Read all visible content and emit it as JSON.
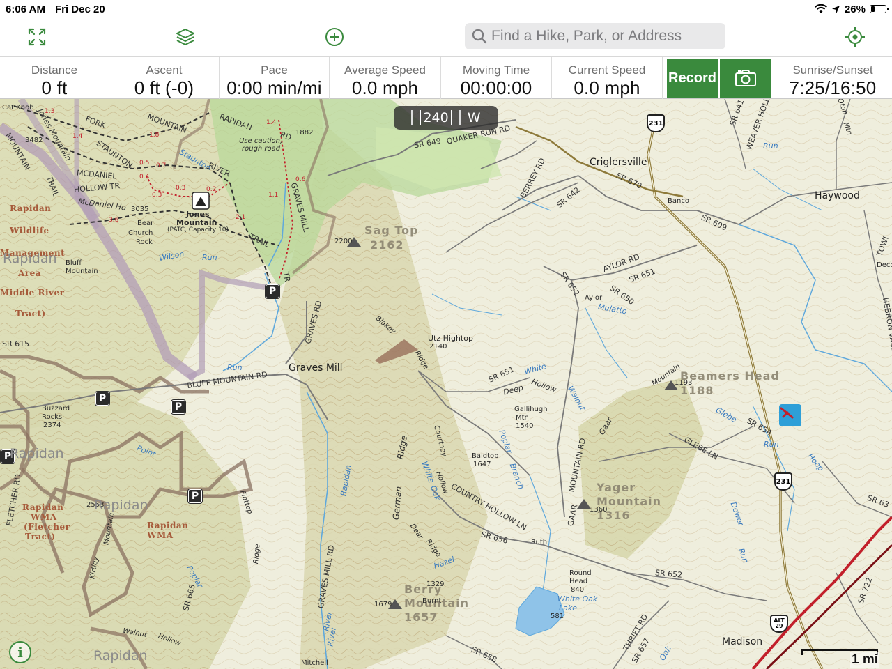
{
  "status": {
    "time": "6:06 AM",
    "date": "Fri Dec 20",
    "battery": "26%",
    "battery_level": 0.26
  },
  "toolbar": {
    "search_placeholder": "Find a Hike, Park, or Address",
    "icons": [
      "expand-icon",
      "layers-icon",
      "add-icon",
      "search-icon",
      "locate-icon"
    ]
  },
  "stats": {
    "distance": {
      "label": "Distance",
      "value": "0 ft"
    },
    "ascent": {
      "label": "Ascent",
      "value": "0 ft (-0)"
    },
    "pace": {
      "label": "Pace",
      "value": "0:00 min/mi"
    },
    "avg_speed": {
      "label": "Average Speed",
      "value": "0.0 mph"
    },
    "moving_time": {
      "label": "Moving Time",
      "value": "00:00:00"
    },
    "current_speed": {
      "label": "Current Speed",
      "value": "0.0 mph"
    },
    "record_label": "Record",
    "sun": {
      "label": "Sunrise/Sunset",
      "value": "7:25/16:50"
    }
  },
  "compass": {
    "heading": "240",
    "direction": "W"
  },
  "scale": {
    "label": "1 mi"
  },
  "map": {
    "towns": {
      "criglersville": "Criglersville",
      "haywood": "Haywood",
      "graves_mill": "Graves Mill",
      "madison": "Madison",
      "banco": "Banco",
      "aylor": "Aylor",
      "ruth": "Ruth"
    },
    "peaks": {
      "sag_top": "Sag Top",
      "sag_top_elev": "2162",
      "beamers_head": "Beamers Head",
      "beamers_elev": "1188",
      "yager": "Yager",
      "yager_mountain": "Mountain",
      "yager_elev": "1316",
      "berry": "Berry",
      "berry_mountain": "Mountain",
      "berry_elev": "1657",
      "utz": "Utz Hightop",
      "utz_elev": "2140",
      "gallihugh": "Gallihugh",
      "gallihugh_mtn": "Mtn",
      "gallihugh_elev": "1540",
      "baldtop": "Baldtop",
      "baldtop_elev": "1647",
      "jones": "Jones",
      "jones_mountain": "Mountain",
      "jones_capacity": "(PATC, Capacity 10)",
      "buzzard": "Buzzard",
      "buzzard_rocks": "Rocks",
      "buzzard_elev": "2374",
      "bear_church": "Bear",
      "bear_church2": "Church",
      "bear_church3": "Rock",
      "bluff": "Bluff",
      "bluff_mountain": "Mountain",
      "round_head": "Round",
      "round_head2": "Head",
      "round_elev": "840",
      "cat_knob": "Cat Knob",
      "elev_3482": "3482",
      "elev_3035": "3035",
      "elev_2200": "2200",
      "elev_1679": "1679",
      "elev_1329": "1329",
      "elev_1360": "1360",
      "elev_2553": "2553",
      "elev_1882": "1882",
      "elev_1193": "1193"
    },
    "areas": {
      "rapidan1": "Rapidan",
      "wildlife": "Wildlife",
      "management": "Management",
      "area": "Area",
      "middle_river": "Middle River",
      "tract": "Tract)",
      "rapidan_wma1": "Rapidan",
      "wma1": "WMA",
      "fletcher": "(Fletcher",
      "fletcher_tract": "Tract)",
      "rapidan_wma2": "Rapidan",
      "wma2": "WMA",
      "rapidan_big1": "Rapidan",
      "rapidan_big2": "Rapidan",
      "rapidan_big3": "Rapidan",
      "rapidan_big4": "Rapidan"
    },
    "roads": {
      "sr649": "SR 649",
      "quaker": "QUAKER RUN RD",
      "berrey": "BERREY RD",
      "sr642": "SR 642",
      "sr670": "SR 670",
      "sr609": "SR 609",
      "aylor_rd": "AYLOR RD",
      "sr651a": "SR 651",
      "sr652a": "SR 652",
      "sr650": "SR 650",
      "sr651b": "SR 651",
      "deep_hollow": "Deep",
      "deep_hollow2": "Hollow",
      "graves_rd": "GRAVES RD",
      "bluff_mtn_rd": "BLUFF MOUNTAIN RD",
      "sr615": "SR 615",
      "graves_mill_rd": "GRAVES MILL RD",
      "fletcher_rd": "FLETCHER RD",
      "country_hollow": "COUNTRY HOLLOW LN",
      "sr656": "SR 656",
      "mountain_rd": "MOUNTAIN RD",
      "gaar": "GAAR",
      "gaar2": "Gaar",
      "glebe_ln": "GLEBE LN",
      "sr654": "SR 654",
      "sr652b": "SR 652",
      "sr658": "SR 658",
      "sr657": "SR 657",
      "thrift_rd": "THRIFT RD",
      "sr665": "SR 665",
      "weaver": "WEAVER HOLL",
      "sr641": "SR 641",
      "hebron": "HEBRON VALLEY R",
      "sr722": "SR 722",
      "sr63": "SR 63",
      "sr670b": "SR 670",
      "fork_mountain": "FORK",
      "fork_mountain2": "MOUNTAIN",
      "staunton": "STAUNTON",
      "rapidan_rd": "RAPIDAN",
      "rd": "RD",
      "river": "RIVER",
      "trail": "TRAIL",
      "tr": "TR",
      "graves_mill_trail": "GRAVES MILL",
      "mcdaniel": "MCDANIEL",
      "hollow_tr": "HOLLOW TR",
      "mcdaniel2": "McDaniel Ho",
      "jones_mountain_trail": "Jones Mountain",
      "mountain_tr": "MOUNTAIN",
      "trail2": "TRAIL",
      "use_caution": "Use caution,",
      "rough_road": "rough road",
      "towe": "TOWI",
      "decor": "Decor",
      "german": "German",
      "ridge": "Ridge",
      "courtney": "Courtney",
      "hollow": "Hollow",
      "dear": "Dear",
      "dear_ridge": "Ridge",
      "walnut": "Walnut",
      "walnut_hollow": "Hollow",
      "blakey": "Blakey",
      "blakey_ridge": "Ridge",
      "kirtley": "Kirtley",
      "kirtley_mountain": "Mountain",
      "flattop": "Flattop",
      "flat_ridge": "Ridge",
      "mitchell": "Mitchell",
      "mountain_label": "Mountain",
      "oton": "Oton",
      "mtn": "Mtn",
      "burnt": "Burnt",
      "alt": "ALT",
      "alt29": "29",
      "route231a": "231",
      "route231b": "231",
      "sr_29": "29"
    },
    "water": {
      "staunton_r": "Staunton",
      "rapidan_r1": "Rapidan",
      "rapidan_r2": "River",
      "white_oak": "White Oak",
      "lake": "Lake",
      "lake_elev": "581",
      "run1": "Run",
      "run2": "Run",
      "run3": "Run",
      "walnut_r": "Walnut",
      "mulatto": "Mulatto",
      "white": "White",
      "poplar_branch": "Poplar",
      "branch": "Branch",
      "dower": "Dower",
      "glebe": "Glebe",
      "hoop": "Hoop",
      "river_r": "River",
      "run4": "Run",
      "oak": "Oak",
      "wilson": "Wilson",
      "run_wilson": "Run",
      "point": "Point",
      "hazel": "Hazel",
      "poplar2": "Poplar",
      "white_oak_r": "White",
      "oak_r": "Oak"
    },
    "trail_miles": [
      "1.3",
      "1.8",
      "1.4",
      "0.5",
      "0.7",
      "0.3",
      "0.3",
      "0.4",
      "3.6",
      "1.4",
      "0.6",
      "1.1",
      "2.1",
      "0.2"
    ],
    "parking_label": "P"
  },
  "colors": {
    "accent": "#3a8a3d",
    "park_boundary": "#8a7060",
    "wilderness": "#b19cb7",
    "water": "#5fa8dc",
    "road": "#6b6b6b",
    "highway": "#8e7a3a",
    "railroad": "#c2202b"
  }
}
